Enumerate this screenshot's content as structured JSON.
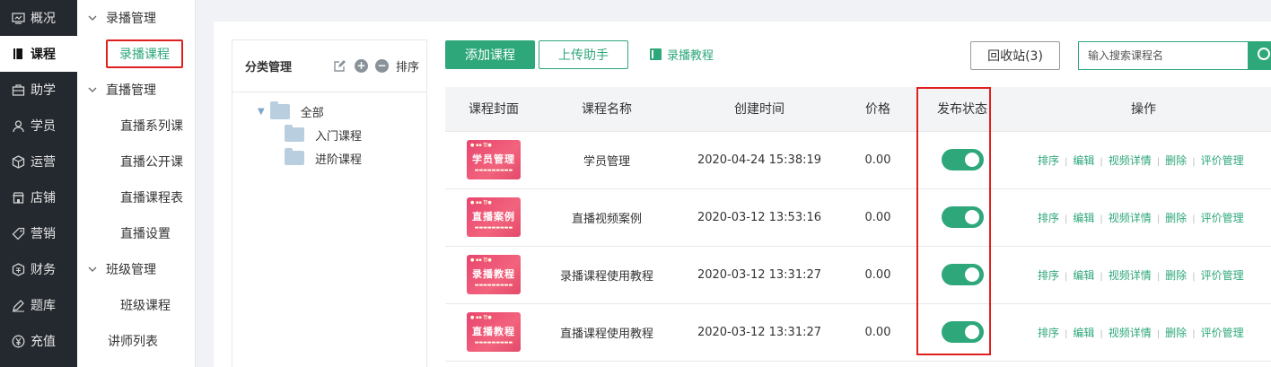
{
  "nav": {
    "items": [
      {
        "label": "概况",
        "icon": "overview-icon"
      },
      {
        "label": "课程",
        "icon": "course-book-icon"
      },
      {
        "label": "助学",
        "icon": "study-aid-icon"
      },
      {
        "label": "学员",
        "icon": "user-icon"
      },
      {
        "label": "运营",
        "icon": "box-icon"
      },
      {
        "label": "店铺",
        "icon": "shop-icon"
      },
      {
        "label": "营销",
        "icon": "tag-icon"
      },
      {
        "label": "财务",
        "icon": "finance-icon"
      },
      {
        "label": "题库",
        "icon": "pen-icon"
      },
      {
        "label": "充值",
        "icon": "yen-icon"
      }
    ],
    "active_index": 1
  },
  "submenu": {
    "group_recorded": "录播管理",
    "recorded_courses": "录播课程",
    "group_live": "直播管理",
    "live_series": "直播系列课",
    "live_public": "直播公开课",
    "live_schedule": "直播课程表",
    "live_settings": "直播设置",
    "group_class": "班级管理",
    "class_courses": "班级课程",
    "teacher_list": "讲师列表"
  },
  "category": {
    "title": "分类管理",
    "sort_label": "排序",
    "root": "全部",
    "children": [
      "入门课程",
      "进阶课程"
    ]
  },
  "toolbar": {
    "add_course": "添加课程",
    "upload_helper": "上传助手",
    "tutorial": "录播教程",
    "recycle_bin": "回收站(3)",
    "search_placeholder": "输入搜索课程名"
  },
  "table": {
    "headers": {
      "cover": "课程封面",
      "name": "课程名称",
      "created": "创建时间",
      "price": "价格",
      "status": "发布状态",
      "ops": "操作"
    },
    "ops_labels": {
      "sort": "排序",
      "edit": "编辑",
      "video": "视频详情",
      "delete": "删除",
      "review": "评价管理"
    },
    "rows": [
      {
        "cover_title": "学员管理",
        "name": "学员管理",
        "created": "2020-04-24 15:38:19",
        "price": "0.00",
        "published": true
      },
      {
        "cover_title": "直播案例",
        "name": "直播视频案例",
        "created": "2020-03-12 13:53:16",
        "price": "0.00",
        "published": true
      },
      {
        "cover_title": "录播教程",
        "name": "录播课程使用教程",
        "created": "2020-03-12 13:31:27",
        "price": "0.00",
        "published": true
      },
      {
        "cover_title": "直播教程",
        "name": "直播课程使用教程",
        "created": "2020-03-12 13:31:27",
        "price": "0.00",
        "published": true
      }
    ]
  },
  "colors": {
    "accent": "#2ea77a",
    "nav_bg": "#24292f",
    "highlight_red": "#e02020",
    "cover_pink": "#e8456f"
  }
}
